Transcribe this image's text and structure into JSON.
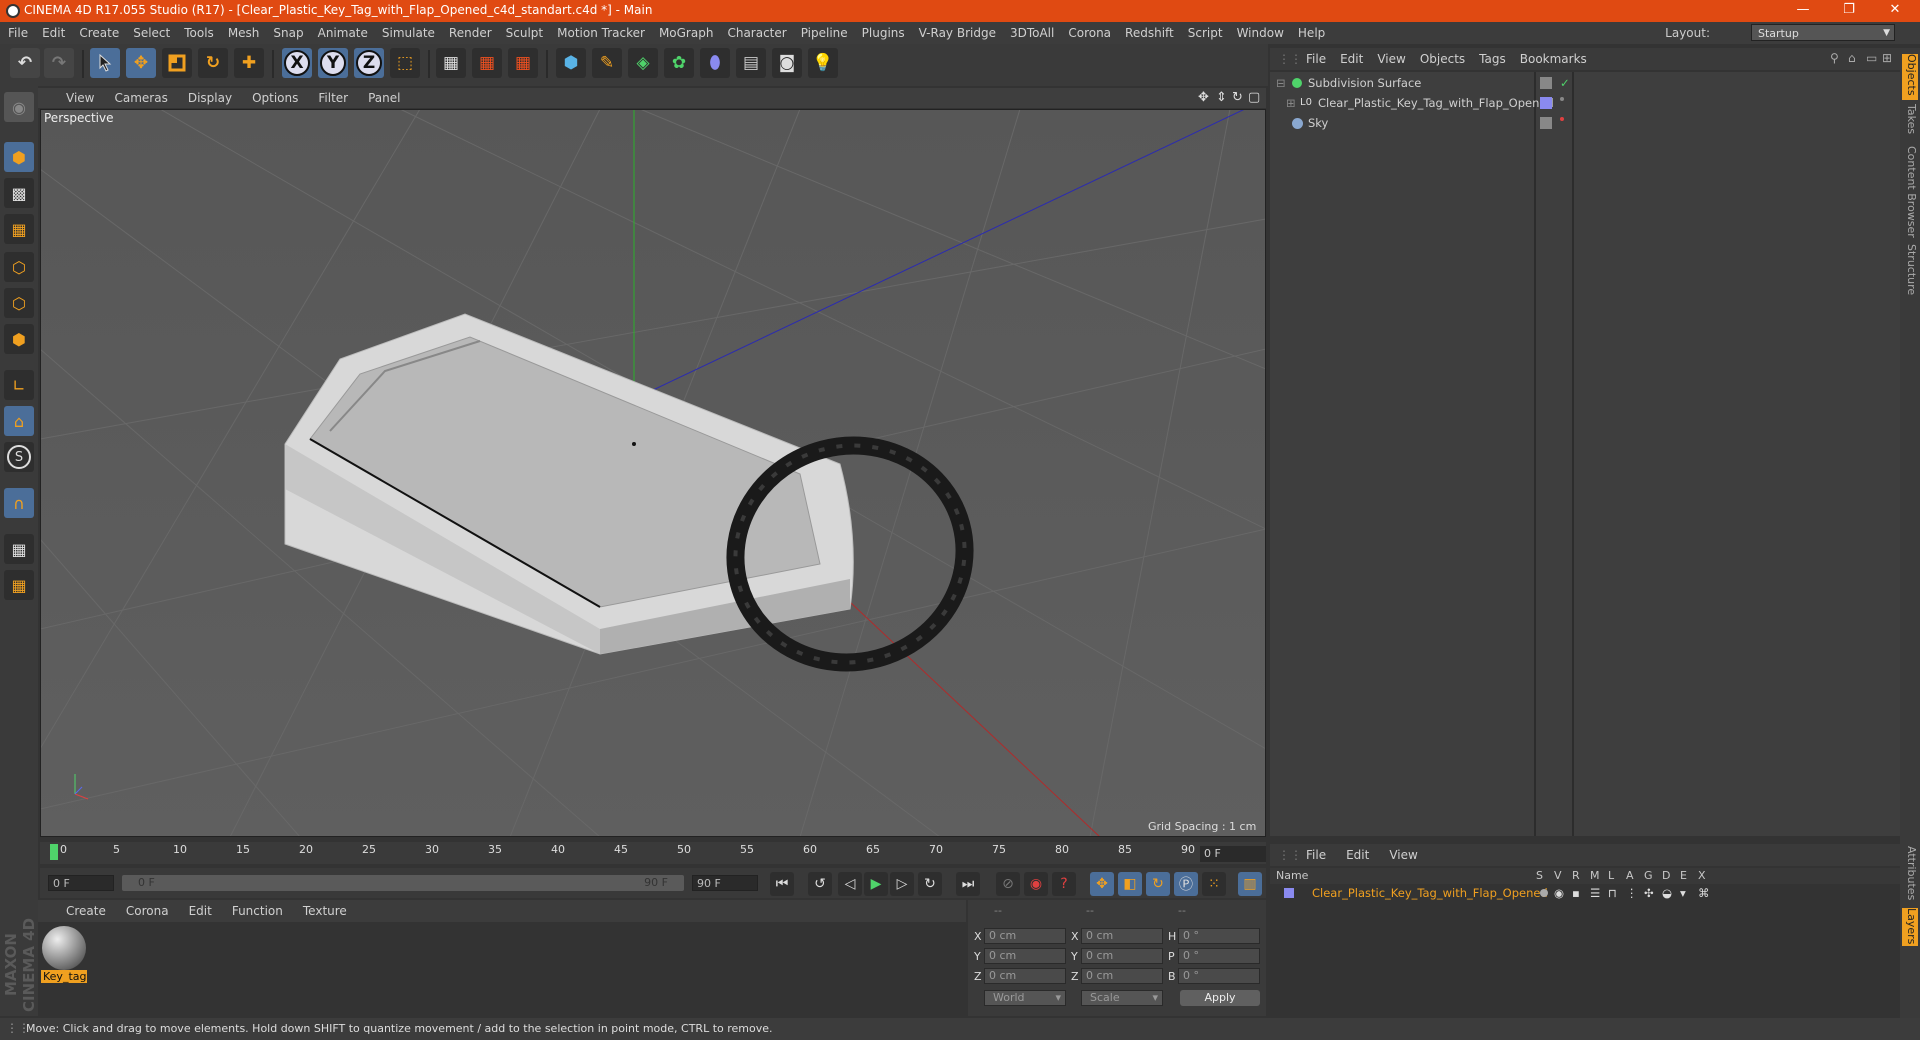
{
  "window": {
    "title": "CINEMA 4D R17.055 Studio (R17) - [Clear_Plastic_Key_Tag_with_Flap_Opened_c4d_standart.c4d *] - Main",
    "controls": {
      "minimize": "—",
      "maximize": "❐",
      "close": "✕"
    }
  },
  "menubar": [
    "File",
    "Edit",
    "Create",
    "Select",
    "Tools",
    "Mesh",
    "Snap",
    "Animate",
    "Simulate",
    "Render",
    "Sculpt",
    "Motion Tracker",
    "MoGraph",
    "Character",
    "Pipeline",
    "Plugins",
    "V-Ray Bridge",
    "3DToAll",
    "Corona",
    "Redshift",
    "Script",
    "Window",
    "Help"
  ],
  "layout": {
    "label": "Layout:",
    "value": "Startup"
  },
  "toolbar": {
    "axis_x": "X",
    "axis_y": "Y",
    "axis_z": "Z"
  },
  "viewport": {
    "menu": [
      "View",
      "Cameras",
      "Display",
      "Options",
      "Filter",
      "Panel"
    ],
    "label": "Perspective",
    "grid_spacing": "Grid Spacing : 1 cm"
  },
  "timeline": {
    "ticks": [
      "0",
      "5",
      "10",
      "15",
      "20",
      "25",
      "30",
      "35",
      "40",
      "45",
      "50",
      "55",
      "60",
      "65",
      "70",
      "75",
      "80",
      "85",
      "90"
    ],
    "current_frame": "0 F",
    "start_field": "0 F",
    "range_start": "0 F",
    "range_end": "90 F",
    "end_field": "90 F"
  },
  "material_manager": {
    "menu": [
      "Create",
      "Corona",
      "Edit",
      "Function",
      "Texture"
    ],
    "materials": [
      {
        "name": "Key_tag"
      }
    ]
  },
  "coordinates": {
    "headers": [
      "--",
      "--",
      "--"
    ],
    "rows": [
      {
        "l1": "X",
        "v1": "0 cm",
        "l2": "X",
        "v2": "0 cm",
        "l3": "H",
        "v3": "0 °"
      },
      {
        "l1": "Y",
        "v1": "0 cm",
        "l2": "Y",
        "v2": "0 cm",
        "l3": "P",
        "v3": "0 °"
      },
      {
        "l1": "Z",
        "v1": "0 cm",
        "l2": "Z",
        "v2": "0 cm",
        "l3": "B",
        "v3": "0 °"
      }
    ],
    "space": "World",
    "mode": "Scale",
    "apply": "Apply"
  },
  "object_manager": {
    "menu": [
      "File",
      "Edit",
      "View",
      "Objects",
      "Tags",
      "Bookmarks"
    ],
    "objects": [
      {
        "name": "Subdivision Surface"
      },
      {
        "name": "Clear_Plastic_Key_Tag_with_Flap_Opened"
      },
      {
        "name": "Sky"
      }
    ]
  },
  "layer_manager": {
    "menu": [
      "File",
      "Edit",
      "View"
    ],
    "header": {
      "name": "Name",
      "flags": [
        "S",
        "V",
        "R",
        "M",
        "L",
        "A",
        "G",
        "D",
        "E",
        "X"
      ]
    },
    "layers": [
      {
        "name": "Clear_Plastic_Key_Tag_with_Flap_Opened"
      }
    ]
  },
  "right_tabs": [
    "Objects",
    "Takes",
    "Content Browser",
    "Structure"
  ],
  "right_tabs_bottom": [
    "Attributes",
    "Layers"
  ],
  "branding": "MAXON CINEMA 4D",
  "status": "Move: Click and drag to move elements. Hold down SHIFT to quantize movement / add to the selection in point mode, CTRL to remove.",
  "colors": {
    "title_bar": "#e04a12",
    "accent": "#f0a020",
    "selected_tool": "#4b6e99"
  }
}
